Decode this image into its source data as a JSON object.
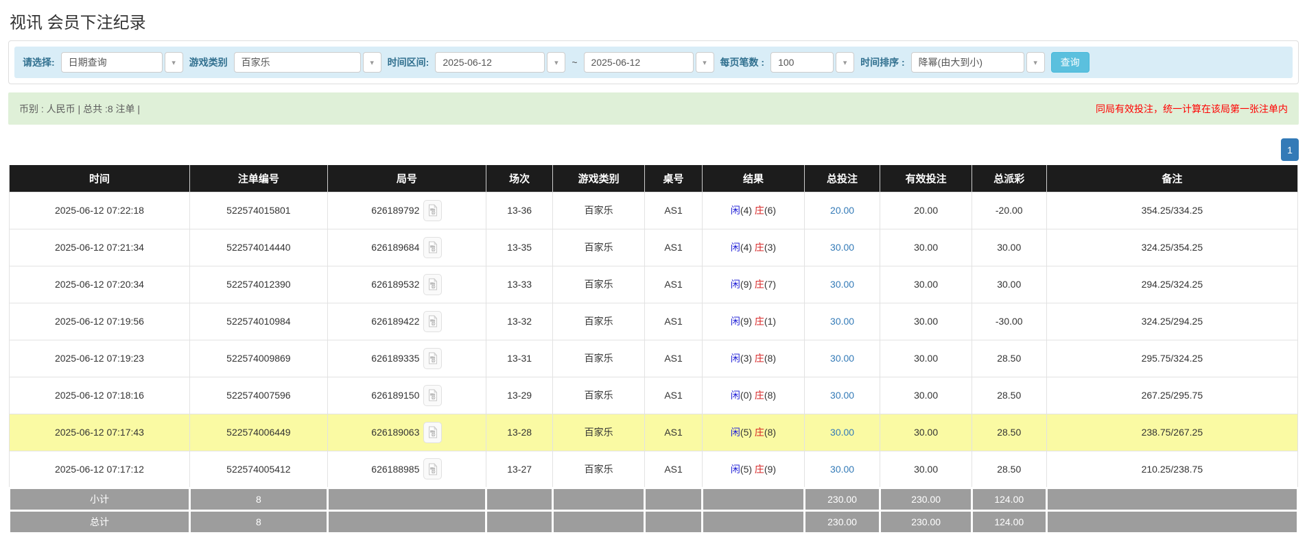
{
  "page": {
    "title": "视讯 会员下注纪录"
  },
  "filter_bar": {
    "query_type": {
      "label": "请选择:",
      "value": "日期查询"
    },
    "game_type": {
      "label": "游戏类别",
      "value": "百家乐"
    },
    "date_range": {
      "label": "时间区间:",
      "from": "2025-06-12",
      "separator": "~",
      "to": "2025-06-12"
    },
    "page_size": {
      "label": "每页笔数 :",
      "value": "100"
    },
    "time_sort": {
      "label": "时间排序 :",
      "value": "降幂(由大到小)"
    },
    "query_button": "查询"
  },
  "icons": {
    "dropdown_caret": "▾"
  },
  "summary_bar": {
    "left_text": "币别 : 人民币 | 总共 :8 注单 |",
    "right_note": "同局有效投注，统一计算在该局第一张注单内"
  },
  "pagination": {
    "pages": [
      "1"
    ]
  },
  "table": {
    "columns": [
      "时间",
      "注单编号",
      "局号",
      "场次",
      "游戏类别",
      "桌号",
      "结果",
      "总投注",
      "有效投注",
      "总派彩",
      "备注"
    ],
    "rows": [
      {
        "time": "2025-06-12 07:22:18",
        "bet_no": "522574015801",
        "round_no": "626189792",
        "session": "13-36",
        "game": "百家乐",
        "table_no": "AS1",
        "player_label": "闲",
        "player_score": "(4)",
        "banker_label": "庄",
        "banker_score": "(6)",
        "total_bet": "20.00",
        "valid_bet": "20.00",
        "payout": "-20.00",
        "remark": "354.25/334.25",
        "highlight": false
      },
      {
        "time": "2025-06-12 07:21:34",
        "bet_no": "522574014440",
        "round_no": "626189684",
        "session": "13-35",
        "game": "百家乐",
        "table_no": "AS1",
        "player_label": "闲",
        "player_score": "(4)",
        "banker_label": "庄",
        "banker_score": "(3)",
        "total_bet": "30.00",
        "valid_bet": "30.00",
        "payout": "30.00",
        "remark": "324.25/354.25",
        "highlight": false
      },
      {
        "time": "2025-06-12 07:20:34",
        "bet_no": "522574012390",
        "round_no": "626189532",
        "session": "13-33",
        "game": "百家乐",
        "table_no": "AS1",
        "player_label": "闲",
        "player_score": "(9)",
        "banker_label": "庄",
        "banker_score": "(7)",
        "total_bet": "30.00",
        "valid_bet": "30.00",
        "payout": "30.00",
        "remark": "294.25/324.25",
        "highlight": false
      },
      {
        "time": "2025-06-12 07:19:56",
        "bet_no": "522574010984",
        "round_no": "626189422",
        "session": "13-32",
        "game": "百家乐",
        "table_no": "AS1",
        "player_label": "闲",
        "player_score": "(9)",
        "banker_label": "庄",
        "banker_score": "(1)",
        "total_bet": "30.00",
        "valid_bet": "30.00",
        "payout": "-30.00",
        "remark": "324.25/294.25",
        "highlight": false
      },
      {
        "time": "2025-06-12 07:19:23",
        "bet_no": "522574009869",
        "round_no": "626189335",
        "session": "13-31",
        "game": "百家乐",
        "table_no": "AS1",
        "player_label": "闲",
        "player_score": "(3)",
        "banker_label": "庄",
        "banker_score": "(8)",
        "total_bet": "30.00",
        "valid_bet": "30.00",
        "payout": "28.50",
        "remark": "295.75/324.25",
        "highlight": false
      },
      {
        "time": "2025-06-12 07:18:16",
        "bet_no": "522574007596",
        "round_no": "626189150",
        "session": "13-29",
        "game": "百家乐",
        "table_no": "AS1",
        "player_label": "闲",
        "player_score": "(0)",
        "banker_label": "庄",
        "banker_score": "(8)",
        "total_bet": "30.00",
        "valid_bet": "30.00",
        "payout": "28.50",
        "remark": "267.25/295.75",
        "highlight": false
      },
      {
        "time": "2025-06-12 07:17:43",
        "bet_no": "522574006449",
        "round_no": "626189063",
        "session": "13-28",
        "game": "百家乐",
        "table_no": "AS1",
        "player_label": "闲",
        "player_score": "(5)",
        "banker_label": "庄",
        "banker_score": "(8)",
        "total_bet": "30.00",
        "valid_bet": "30.00",
        "payout": "28.50",
        "remark": "238.75/267.25",
        "highlight": true
      },
      {
        "time": "2025-06-12 07:17:12",
        "bet_no": "522574005412",
        "round_no": "626188985",
        "session": "13-27",
        "game": "百家乐",
        "table_no": "AS1",
        "player_label": "闲",
        "player_score": "(5)",
        "banker_label": "庄",
        "banker_score": "(9)",
        "total_bet": "30.00",
        "valid_bet": "30.00",
        "payout": "28.50",
        "remark": "210.25/238.75",
        "highlight": false
      }
    ],
    "subtotal": {
      "label": "小计",
      "count": "8",
      "total_bet": "230.00",
      "valid_bet": "230.00",
      "payout": "124.00"
    },
    "total": {
      "label": "总计",
      "count": "8",
      "total_bet": "230.00",
      "valid_bet": "230.00",
      "payout": "124.00"
    }
  },
  "colors": {
    "header_bg": "#1c1c1c",
    "filter_bar_bg": "#d9edf7",
    "filter_label": "#31708f",
    "summary_bg": "#dff0d8",
    "note_red": "#ff0000",
    "query_button_bg": "#5bc0de",
    "pagination_active_bg": "#337ab7",
    "link_blue": "#337ab7",
    "player_blue": "#2323d6",
    "banker_red": "#d62323",
    "negative_red": "#ff0000",
    "highlight_yellow": "#fafaa3",
    "footer_gray": "#9d9d9d"
  }
}
